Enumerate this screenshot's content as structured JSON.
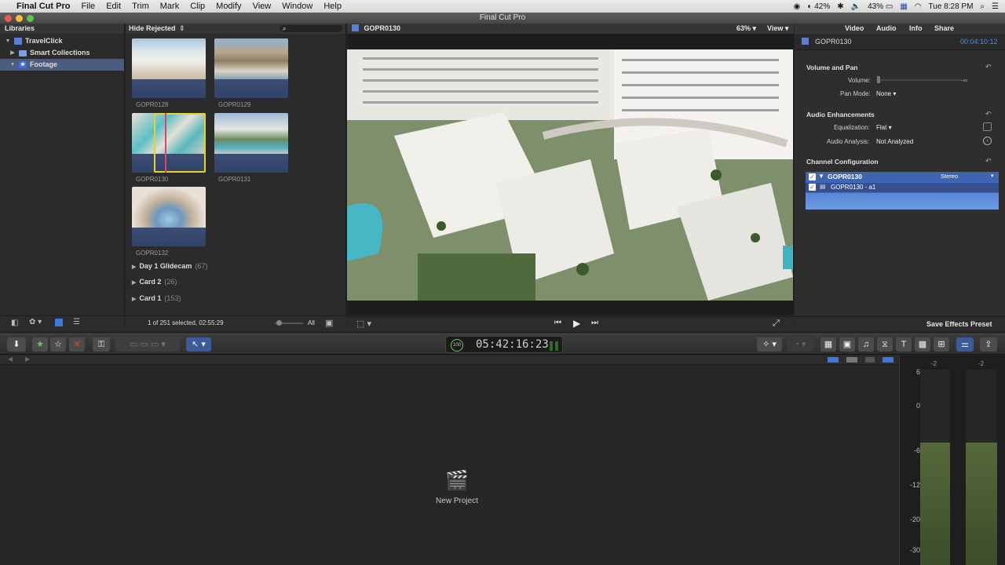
{
  "menubar": {
    "app_name": "Final Cut Pro",
    "menus": [
      "File",
      "Edit",
      "Trim",
      "Mark",
      "Clip",
      "Modify",
      "View",
      "Window",
      "Help"
    ],
    "status": {
      "battery_left": "42%",
      "battery_right": "43%",
      "clock": "Tue 8:28 PM"
    }
  },
  "window": {
    "title": "Final Cut Pro"
  },
  "libraries": {
    "header": "Libraries",
    "items": [
      {
        "label": "TravelClick"
      },
      {
        "label": "Smart Collections"
      },
      {
        "label": "Footage"
      }
    ]
  },
  "browser": {
    "filter": "Hide Rejected",
    "clips": [
      {
        "name": "GOPR0128"
      },
      {
        "name": "GOPR0129"
      },
      {
        "name": "GOPR0130"
      },
      {
        "name": "GOPR0131"
      },
      {
        "name": "GOPR0132"
      }
    ],
    "events": [
      {
        "name": "Day 1 Glidecam",
        "count": "(67)"
      },
      {
        "name": "Card 2",
        "count": "(26)"
      },
      {
        "name": "Card 1",
        "count": "(153)"
      }
    ],
    "selection_status": "1 of 251 selected, 02:55:29",
    "all_label": "All"
  },
  "viewer": {
    "clip_name": "GOPR0130",
    "zoom": "63%",
    "view_label": "View"
  },
  "inspector": {
    "tabs": [
      "Video",
      "Audio",
      "Info",
      "Share"
    ],
    "clip_name": "GOPR0130",
    "duration": "00:04:10:12",
    "sections": {
      "volume_pan": "Volume and Pan",
      "volume_label": "Volume:",
      "volume_value": "-∞",
      "pan_mode_label": "Pan Mode:",
      "pan_mode_value": "None",
      "enhancements": "Audio Enhancements",
      "eq_label": "Equalization:",
      "eq_value": "Flat",
      "analysis_label": "Audio Analysis:",
      "analysis_value": "Not Analyzed",
      "channel_config": "Channel Configuration",
      "channel_clip": "GOPR0130",
      "channel_mode": "Stereo",
      "channel_sub": "GOPR0130 - a1"
    },
    "save_preset": "Save Effects Preset"
  },
  "toolbar": {
    "timecode": "05:42:16:23",
    "timecode_badge": "100"
  },
  "timeline": {
    "empty_label": "New Project"
  },
  "meters": {
    "peak_labels": [
      "-2",
      "-2"
    ],
    "scale": [
      "6",
      "0",
      "-6",
      "-12",
      "-20",
      "-30"
    ]
  }
}
